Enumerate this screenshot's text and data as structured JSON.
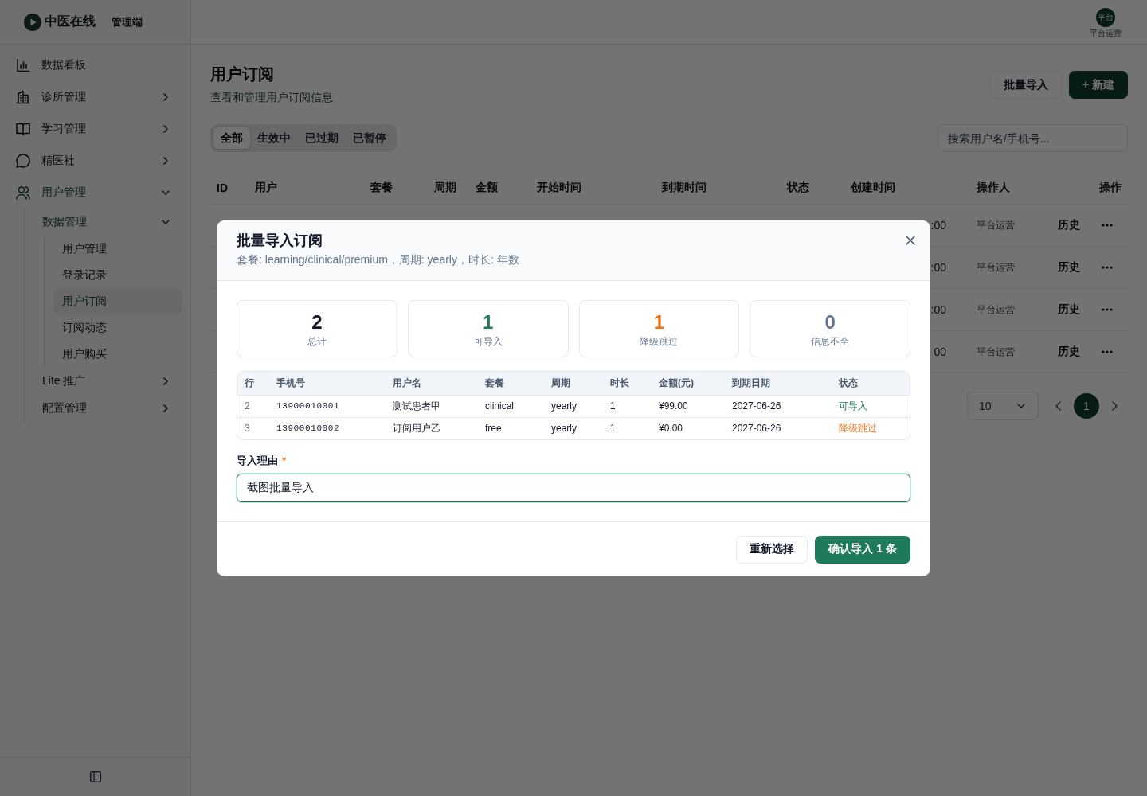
{
  "sidebar": {
    "brand": {
      "name": "中医在线",
      "suffix": "管理端"
    },
    "items": [
      {
        "kind": "link",
        "label": "数据看板",
        "selected": false
      },
      {
        "kind": "group",
        "label": "诊所管理",
        "expanded": false
      },
      {
        "kind": "group",
        "label": "学习管理",
        "expanded": false
      },
      {
        "kind": "group",
        "label": "精医社",
        "expanded": false
      },
      {
        "kind": "group",
        "label": "用户管理",
        "expanded": true,
        "children": [
          {
            "kind": "group",
            "label": "数据管理",
            "expanded": true,
            "children": [
              {
                "kind": "link",
                "label": "用户管理",
                "selected": false
              },
              {
                "kind": "link",
                "label": "登录记录",
                "selected": false
              },
              {
                "kind": "link",
                "label": "用户订阅",
                "selected": true
              },
              {
                "kind": "link",
                "label": "订阅动态",
                "selected": false
              },
              {
                "kind": "link",
                "label": "用户购买",
                "selected": false
              }
            ]
          },
          {
            "kind": "group",
            "label": "Lite 推广",
            "expanded": false
          },
          {
            "kind": "group",
            "label": "配置管理",
            "expanded": false
          }
        ]
      }
    ]
  },
  "top_bar": {
    "user": {
      "avatar_text": "平台",
      "name": "平台运营"
    }
  },
  "page": {
    "title": "用户订阅",
    "subtitle": "查看和管理用户订阅信息",
    "actions": [
      {
        "kind": "secondary",
        "label": "批量导入"
      },
      {
        "kind": "primary",
        "label": "+ 新建"
      }
    ],
    "tabs": [
      {
        "label": "全部",
        "selected": true
      },
      {
        "label": "生效中",
        "selected": false
      },
      {
        "label": "已过期",
        "selected": false
      },
      {
        "label": "已暂停",
        "selected": false
      }
    ],
    "search": {
      "placeholder": "搜索用户名/手机号..."
    },
    "table": {
      "columns": [
        "ID",
        "用户",
        "套餐",
        "周期",
        "金额",
        "开始时间",
        "到期时间",
        "状态",
        "创建时间",
        "操作人",
        "操作"
      ],
      "rows": [
        {
          "created_time": ":00",
          "operator": "平台运营",
          "action": "历史"
        },
        {
          "created_time": ":00",
          "operator": "平台运营",
          "action": "历史"
        },
        {
          "created_time": ":00",
          "operator": "平台运营",
          "action": "历史"
        },
        {
          "created_time": "00",
          "operator": "平台运营",
          "action": "历史"
        }
      ]
    },
    "pagination": {
      "page_size": "10",
      "pages": [
        {
          "label": "1",
          "selected": true
        }
      ]
    }
  },
  "modal": {
    "title": "批量导入订阅",
    "subtitle": "套餐: learning/clinical/premium，周期: yearly，时长: 年数",
    "stats": [
      {
        "kind": "total",
        "value": "2",
        "label": "总计"
      },
      {
        "kind": "ok",
        "value": "1",
        "label": "可导入"
      },
      {
        "kind": "skip",
        "value": "1",
        "label": "降级跳过"
      },
      {
        "kind": "incomplete",
        "value": "0",
        "label": "信息不全"
      }
    ],
    "preview": {
      "columns": [
        "行",
        "手机号",
        "用户名",
        "套餐",
        "周期",
        "时长",
        "金额(元)",
        "到期日期",
        "状态"
      ],
      "rows": [
        {
          "row": "2",
          "phone": "13900010001",
          "name": "测试患者甲",
          "plan": "clinical",
          "cycle": "yearly",
          "duration": "1",
          "amount": "¥99.00",
          "expiry": "2027-06-26",
          "status": {
            "text": "可导入",
            "kind": "ok"
          }
        },
        {
          "row": "3",
          "phone": "13900010002",
          "name": "订阅用户乙",
          "plan": "free",
          "cycle": "yearly",
          "duration": "1",
          "amount": "¥0.00",
          "expiry": "2027-06-26",
          "status": {
            "text": "降级跳过",
            "kind": "skip"
          }
        }
      ]
    },
    "reason": {
      "label": "导入理由",
      "required_mark": "*",
      "value": "截图批量导入",
      "focused": true
    },
    "buttons": [
      {
        "kind": "secondary",
        "label": "重新选择"
      },
      {
        "kind": "primary",
        "label": "确认导入 1 条"
      }
    ]
  }
}
